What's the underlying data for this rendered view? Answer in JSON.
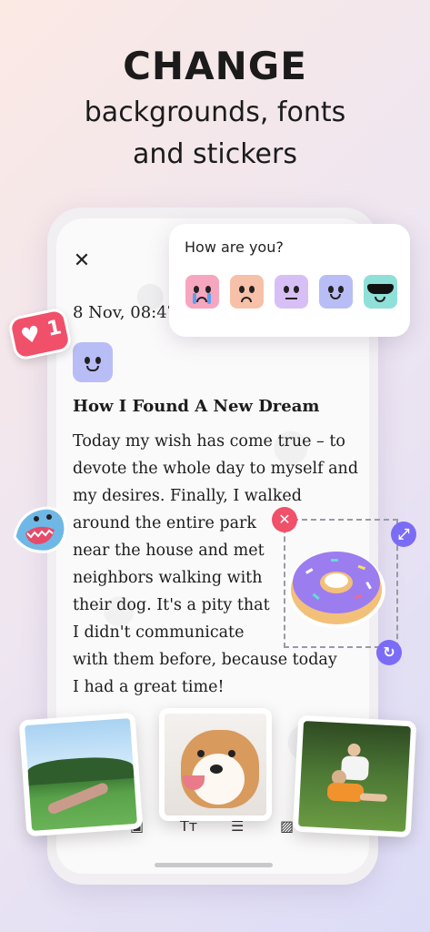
{
  "headline": {
    "title": "CHANGE",
    "subtitle_line1": "backgrounds, fonts",
    "subtitle_line2": "and stickers"
  },
  "editor": {
    "date": "8 Nov, 08:47",
    "entry_title": "How I Found A New Dream",
    "body_lines": [
      "Today my wish has come true – to",
      "devote the whole day to myself and",
      "my desires. Finally, I walked",
      "around the entire park",
      "near the house and met",
      "neighbors walking with",
      "their dog. It's a pity that",
      "I didn't communicate",
      "with them before, because today",
      "I had a great time!"
    ]
  },
  "mood_popup": {
    "question": "How are you?",
    "moods": [
      {
        "name": "crying",
        "color": "#f7a6bf"
      },
      {
        "name": "sad",
        "color": "#f6c1a8"
      },
      {
        "name": "neutral",
        "color": "#d7bff6"
      },
      {
        "name": "happy",
        "color": "#b9bdf6"
      },
      {
        "name": "cool",
        "color": "#8fe0d8"
      }
    ]
  },
  "stickers": {
    "like_count": "1"
  },
  "colors": {
    "accent": "#7b6cf6",
    "delete": "#f0506a"
  }
}
